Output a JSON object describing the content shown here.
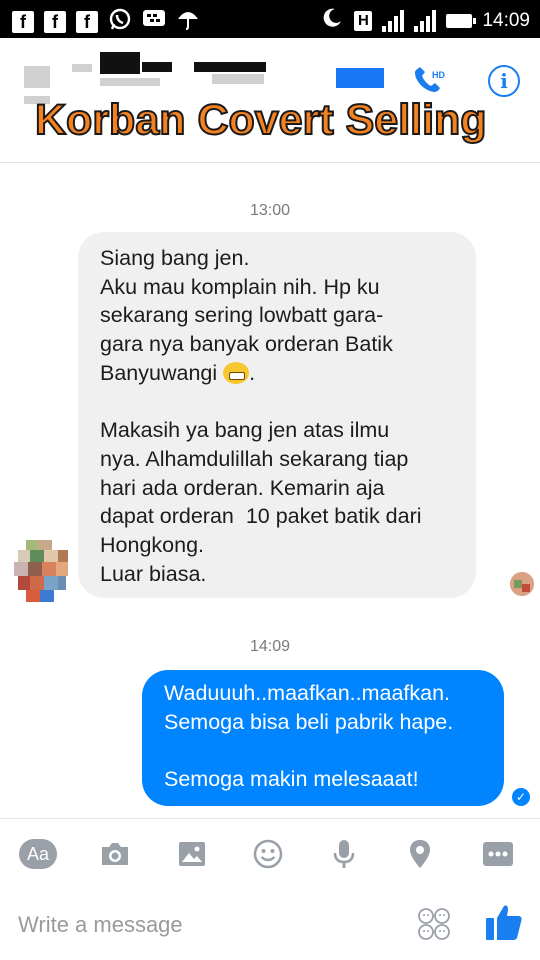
{
  "status_bar": {
    "time": "14:09",
    "network_label": "H",
    "left_icons": [
      "facebook-icon",
      "facebook-icon",
      "facebook-icon",
      "whatsapp-icon",
      "bbm-icon",
      "umbrella-icon"
    ]
  },
  "header": {
    "overlay_title": "Korban Covert Selling",
    "call_badge": "HD",
    "info_symbol": "i"
  },
  "messages": [
    {
      "timestamp": "13:00",
      "direction": "incoming",
      "lines_1": "Siang bang jen.\nAku mau komplain nih. Hp ku\nsekarang sering lowbatt gara-\ngara nya banyak orderan Batik\nBanyuwangi ",
      "lines_1_end": ".",
      "lines_2": "Makasih ya bang jen atas ilmu\nnya. Alhamdulillah sekarang tiap\nhari ada orderan. Kemarin aja\ndapat orderan  10 paket batik dari\nHongkong.\nLuar biasa."
    },
    {
      "timestamp": "14:09",
      "direction": "outgoing",
      "lines_1": "Waduuuh..maafkan..maafkan.\nSemoga bisa beli pabrik hape.",
      "lines_2": "Semoga makin melesaaat!"
    }
  ],
  "toolbar": {
    "aa_label": "Aa",
    "icons": [
      "camera-icon",
      "gallery-icon",
      "emoji-icon",
      "microphone-icon",
      "location-icon",
      "more-icon"
    ]
  },
  "composer": {
    "placeholder": "Write a message"
  },
  "colors": {
    "accent": "#0084ff",
    "title_orange": "#f58220"
  }
}
